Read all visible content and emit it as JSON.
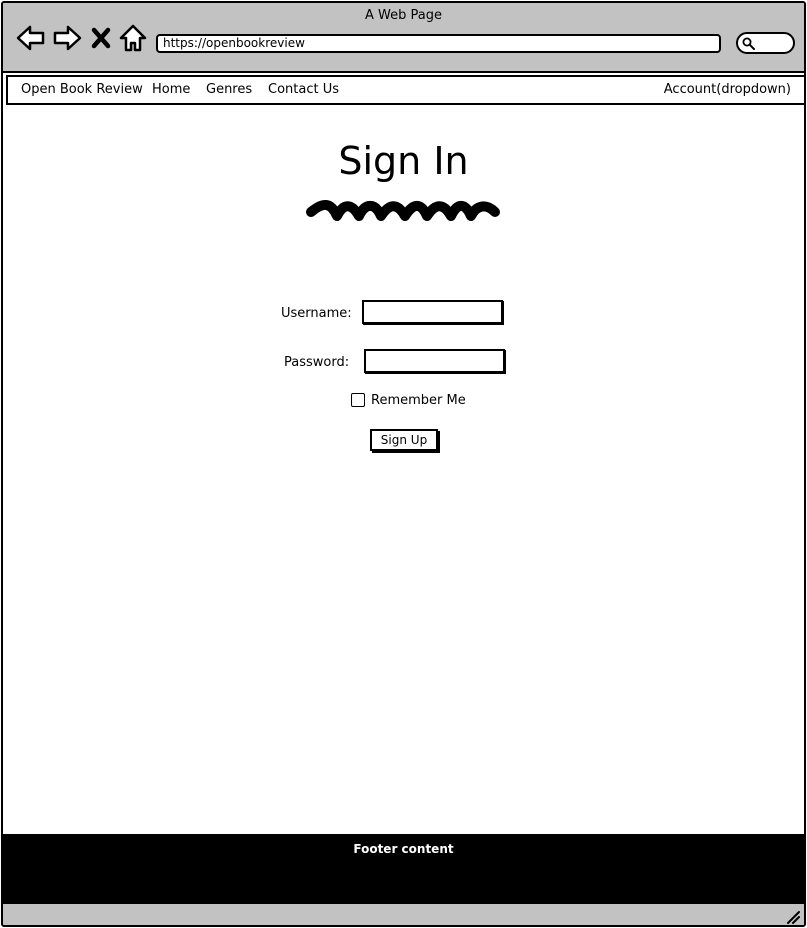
{
  "window": {
    "title": "A Web Page"
  },
  "browser": {
    "url": "https://openbookreview",
    "icons": [
      "back-arrow-icon",
      "forward-arrow-icon",
      "close-x-icon",
      "home-icon",
      "search-icon",
      "resize-grip-icon"
    ]
  },
  "navbar": {
    "brand": "Open Book Review",
    "links": [
      "Home",
      "Genres",
      "Contact Us"
    ],
    "account": "Account(dropdown)"
  },
  "main": {
    "title": "Sign In",
    "form": {
      "username_label": "Username:",
      "username_value": "",
      "password_label": "Password:",
      "password_value": "",
      "remember_label": "Remember Me",
      "remember_checked": false,
      "submit_label": "Sign Up"
    }
  },
  "footer": {
    "text": "Footer content"
  }
}
